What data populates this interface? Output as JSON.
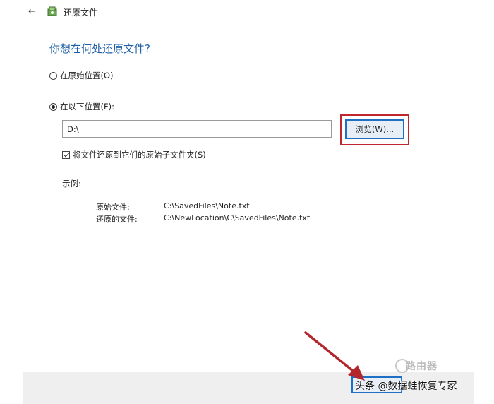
{
  "titlebar": {
    "back_glyph": "←",
    "title": "还原文件",
    "app_icon": "backup-restore-icon"
  },
  "heading": "你想在何处还原文件?",
  "options": {
    "original_location": "在原始位置(O)",
    "following_location": "在以下位置(F):",
    "selected": "following_location"
  },
  "path_input": {
    "value": "D:\\"
  },
  "browse_button": {
    "label": "浏览(W)..."
  },
  "subfolder_checkbox": {
    "label": "将文件还原到它们的原始子文件夹(S)",
    "checked": true
  },
  "example": {
    "label": "示例:",
    "rows": [
      {
        "key": "原始文件:",
        "value": "C:\\SavedFiles\\Note.txt"
      },
      {
        "key": "还原的文件:",
        "value": "C:\\NewLocation\\C\\SavedFiles\\Note.txt"
      }
    ]
  },
  "watermark": {
    "text": "头条 @数据蛙恢复专家",
    "logo_text": "路由器"
  },
  "colors": {
    "heading": "#1f5fa6",
    "highlight_box": "#c0262d",
    "button_border": "#1f6fc5",
    "arrow": "#b3262b"
  }
}
